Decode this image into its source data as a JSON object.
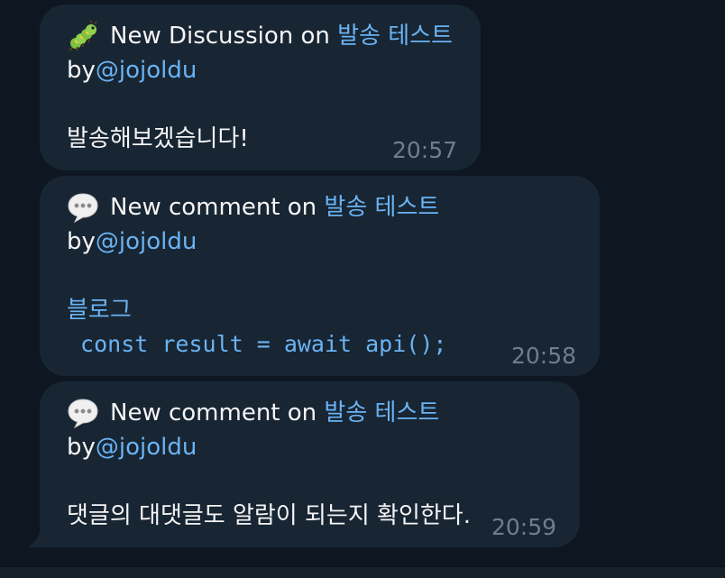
{
  "messages": [
    {
      "icon": "bug-icon",
      "title_prefix": "New Discussion on",
      "title_link": "발송 테스트",
      "by_label": "by",
      "author": "@jojoldu",
      "body": "발송해보겠습니다!",
      "time": "20:57"
    },
    {
      "icon": "speech-balloon-icon",
      "title_prefix": "New comment on",
      "title_link": "발송 테스트",
      "by_label": "by",
      "author": "@jojoldu",
      "body_link": "블로그",
      "code": " const result = await api();",
      "time": "20:58"
    },
    {
      "icon": "speech-balloon-icon",
      "title_prefix": "New comment on",
      "title_link": "발송 테스트",
      "by_label": "by",
      "author": "@jojoldu",
      "body": "댓글의 대댓글도 알람이 되는지 확인한다.",
      "time": "20:59"
    }
  ],
  "colors": {
    "background": "#0e1621",
    "bubble": "#182533",
    "link": "#6ab3f3",
    "text": "#f5f5f5",
    "time": "#6d7f8f"
  }
}
